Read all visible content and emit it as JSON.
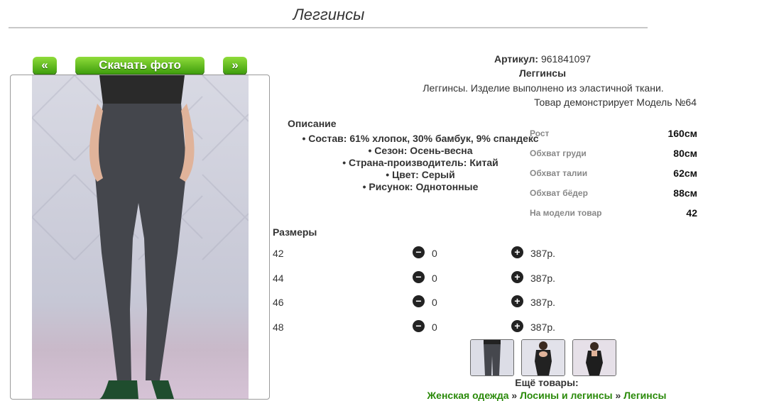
{
  "page": {
    "title": "Леггинсы"
  },
  "nav": {
    "prev_label": "«",
    "download_label": "Скачать фото",
    "next_label": "»"
  },
  "product": {
    "article_label": "Артикул:",
    "article_value": "961841097",
    "name": "Леггинсы",
    "short_desc": "Леггинсы. Изделие выполнено из эластичной ткани.",
    "model_note": "Товар демонстрирует Модель №64"
  },
  "description": {
    "title": "Описание",
    "items": [
      "Состав: 61% хлопок, 30% бамбук, 9% спандекс",
      "Сезон: Осень-весна",
      "Страна-производитель: Китай",
      "Цвет: Серый",
      "Рисунок: Однотонные"
    ]
  },
  "model_measures": [
    {
      "label": "Рост",
      "value": "160см"
    },
    {
      "label": "Обхват груди",
      "value": "80см"
    },
    {
      "label": "Обхват талии",
      "value": "62см"
    },
    {
      "label": "Обхват бёдер",
      "value": "88см"
    },
    {
      "label": "На модели товар",
      "value": "42"
    }
  ],
  "sizes": {
    "title": "Размеры",
    "rows": [
      {
        "size": "42",
        "qty": "0",
        "price": "387р."
      },
      {
        "size": "44",
        "qty": "0",
        "price": "387р."
      },
      {
        "size": "46",
        "qty": "0",
        "price": "387р."
      },
      {
        "size": "48",
        "qty": "0",
        "price": "387р."
      }
    ],
    "minus_icon": "minus-circle-icon",
    "plus_icon": "plus-circle-icon"
  },
  "more": {
    "label": "Ещё товары:",
    "crumbs": [
      "Женская одежда",
      "Лосины и легинсы",
      "Легинсы"
    ],
    "sep": "»"
  },
  "colors": {
    "accent_green": "#3f9e0d",
    "link_green": "#2a8a0a"
  }
}
